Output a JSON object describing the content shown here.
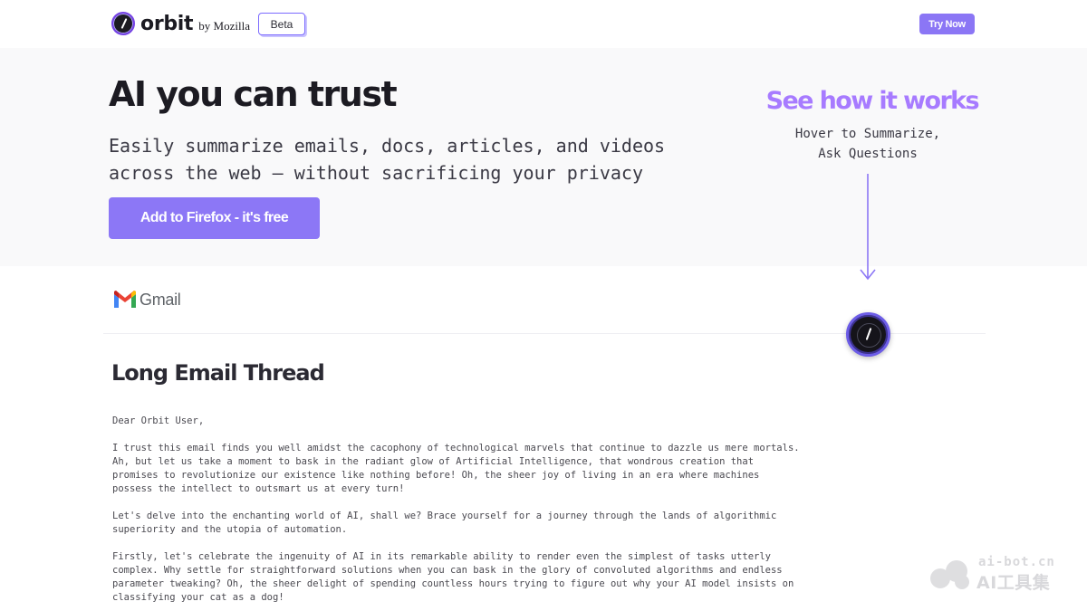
{
  "header": {
    "brand": "orbit",
    "brand_by": "by Mozilla",
    "beta_label": "Beta",
    "try_now_label": "Try Now"
  },
  "hero": {
    "title": "AI you can trust",
    "subtitle_lines": [
      "Easily summarize emails, docs, articles, and videos",
      "across the web – without sacrificing your privacy"
    ],
    "cta_label": "Add to Firefox - it's free",
    "see_how_title": "See how it works",
    "see_how_lines": [
      "Hover to Summarize,",
      "Ask Questions"
    ]
  },
  "demo": {
    "app_name": "Gmail",
    "email_title": "Long Email Thread",
    "email_paragraphs": [
      [
        "Dear Orbit User,"
      ],
      [
        "I trust this email finds you well amidst the cacophony of technological marvels that continue to dazzle us mere mortals.",
        "Ah, but let us take a moment to bask in the radiant glow of Artificial Intelligence, that wondrous creation that",
        "promises to revolutionize our existence like nothing before! Oh, the sheer joy of living in an era where machines",
        "possess the intellect to outsmart us at every turn!"
      ],
      [
        "Let's delve into the enchanting world of AI, shall we? Brace yourself for a journey through the lands of algorithmic",
        "superiority and the utopia of automation."
      ],
      [
        "Firstly, let's celebrate the ingenuity of AI in its remarkable ability to render even the simplest of tasks utterly",
        "complex. Why settle for straightforward solutions when you can bask in the glory of convoluted algorithms and endless",
        "parameter tweaking? Oh, the sheer delight of spending countless hours trying to figure out why your AI model insists on",
        "classifying your cat as a dog!"
      ]
    ]
  },
  "watermark": {
    "top": "ai-bot.cn",
    "bottom": "AI工具集"
  },
  "colors": {
    "accent": "#8c77f6",
    "accent_light": "#a77bff",
    "hero_bg": "#f9f9fa"
  }
}
